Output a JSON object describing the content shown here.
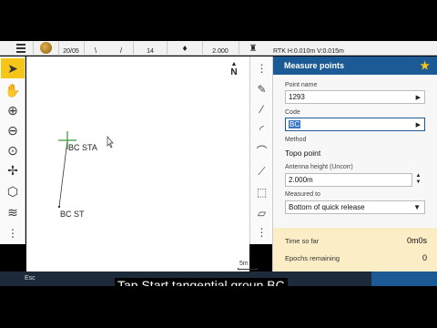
{
  "statusbar": {
    "epoch": "20/05",
    "satellites": "14",
    "antenna": "2.000",
    "precision": "RTK H:0.010m V:0.015m"
  },
  "map": {
    "north_label": "N",
    "points": [
      {
        "label": "BC STA"
      },
      {
        "label": "BC ST"
      }
    ],
    "scale_label": "5m"
  },
  "panel": {
    "title": "Measure points",
    "point_name_label": "Point name",
    "point_name_value": "1293",
    "code_label": "Code",
    "code_value": "BC",
    "method_label": "Method",
    "method_value": "Topo point",
    "antenna_label": "Antenna height (Uncorr)",
    "antenna_value": "2.000m",
    "measured_to_label": "Measured to",
    "measured_to_value": "Bottom of quick release",
    "time_label": "Time so far",
    "time_value": "0m0s",
    "epochs_label": "Epochs remaining",
    "epochs_value": "0"
  },
  "bottombar": {
    "esc_label": "Esc",
    "caption": "Tap Start tangential group BC"
  },
  "colors": {
    "accent": "#1c5a96",
    "highlight": "#f5c518",
    "info_bg": "#fbeec6"
  },
  "icons": [
    "menu-icon",
    "globe-icon",
    "satellite-icon",
    "antenna-icon",
    "select-arrow-icon",
    "pan-hand-icon",
    "zoom-in-icon",
    "zoom-out-icon",
    "zoom-extents-icon",
    "orbit-icon",
    "cube-icon",
    "layers-icon",
    "more-icon",
    "star-icon"
  ]
}
